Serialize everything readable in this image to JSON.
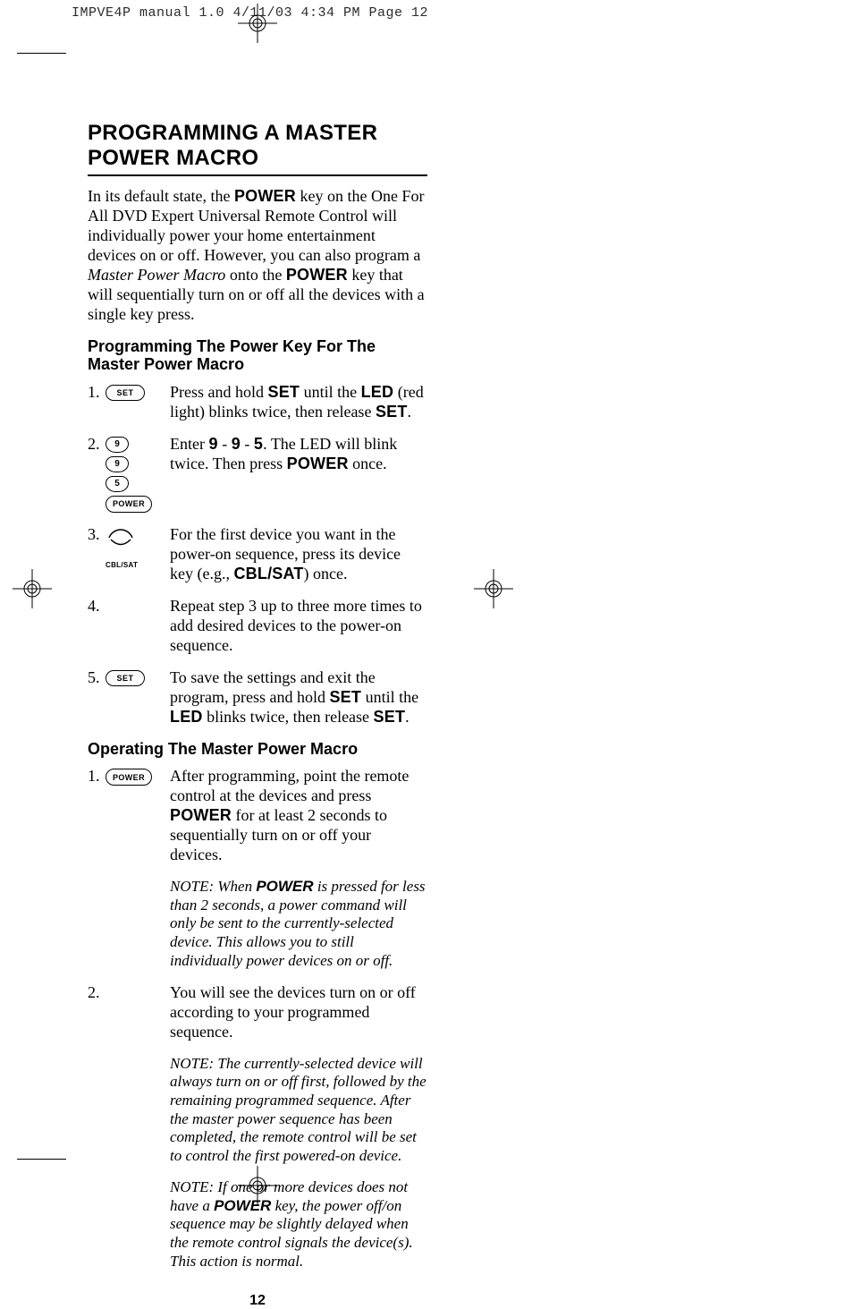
{
  "slug": "IMPVE4P manual 1.0  4/11/03  4:34 PM  Page 12",
  "section_title": "PROGRAMMING A MASTER POWER MACRO",
  "intro": {
    "line1_pre": "In its default state, the ",
    "line1_bold": "POWER",
    "line1_post": " key on the One For All DVD Expert Universal Remote Control will individually power your home entertainment devices on or off. However, you can also program a ",
    "line1_italic": "Master Power Macro",
    "line2_pre": " onto the ",
    "line2_bold": "POWER",
    "line2_post": " key that will sequentially turn on or off all the devices with a single key press."
  },
  "subA_title": "Programming The Power Key For The Master Power Macro",
  "labels": {
    "set": "SET",
    "power": "POWER",
    "nine": "9",
    "five": "5",
    "cblsat": "CBL/SAT"
  },
  "stepsA": {
    "s1": {
      "num": "1.",
      "t1": "Press and hold ",
      "b1": "SET",
      "t2": " until the ",
      "b2": "LED",
      "t3": " (red light) blinks twice, then release ",
      "b3": "SET",
      "t4": "."
    },
    "s2": {
      "num": "2.",
      "t1": "Enter ",
      "b1": "9",
      "t2": " - ",
      "b2": "9",
      "t3": " - ",
      "b3": "5",
      "t4": ". The LED will blink twice. Then press ",
      "b4": "POWER",
      "t5": " once."
    },
    "s3": {
      "num": "3.",
      "t1": "For the first device you want in the power-on sequence, press its device key (e.g., ",
      "b1": "CBL/SAT",
      "t2": ") once."
    },
    "s4": {
      "num": "4.",
      "t1": "Repeat step 3 up to three more times to add desired devices to the power-on sequence."
    },
    "s5": {
      "num": "5.",
      "t1": "To save the settings and exit the program, press and hold ",
      "b1": "SET",
      "t2": " until the ",
      "b2": "LED",
      "t3": " blinks twice, then release ",
      "b3": "SET",
      "t4": "."
    }
  },
  "subB_title": "Operating The Master Power Macro",
  "stepsB": {
    "s1": {
      "num": "1.",
      "t1": "After programming, point the remote control at the devices and press ",
      "b1": "POWER",
      "t2": " for at least 2 seconds to sequentially turn on or off your devices."
    },
    "n1": {
      "t1": "NOTE: When ",
      "b1": "POWER",
      "t2": " is pressed for less than 2 seconds, a power command will only be sent to the currently-selected device. This allows you to still individually power devices on or off."
    },
    "s2": {
      "num": "2.",
      "t1": "You will see the devices turn on or off according to your programmed sequence."
    },
    "n2": {
      "t1": "NOTE: The currently-selected device will always turn on or off first, followed by the remaining programmed sequence. After the master power sequence has been completed, the remote control will be set to control the first powered-on device."
    },
    "n3": {
      "t1": "NOTE: If one or more devices does not have a ",
      "b1": "POWER",
      "t2": " key, the power off/on sequence may be slightly delayed when the remote control signals the device(s). This action is normal."
    }
  },
  "page_number": "12"
}
